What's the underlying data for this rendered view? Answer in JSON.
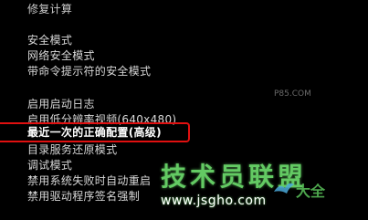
{
  "boot_menu": {
    "header": "修复计算",
    "items": [
      "安全模式",
      "网络安全模式",
      "带命令提示符的安全模式",
      "启用启动日志",
      "启用低分辨率视频(640x480)",
      "最近一次的正确配置(高级)",
      "目录服务还原模式",
      "调试模式",
      "禁用系统失败时自动重启",
      "禁用驱动程序签名强制"
    ],
    "selected_index": 5
  },
  "watermark": {
    "logo_text": "技术员联盟",
    "url_text": "www.jsgho.com",
    "site_text": "P85.COM",
    "brand2_text": "大全"
  },
  "colors": {
    "background": "#000000",
    "text": "#d7d7d7",
    "selection_border": "#e01010",
    "watermark_green": "#6ee06e"
  }
}
